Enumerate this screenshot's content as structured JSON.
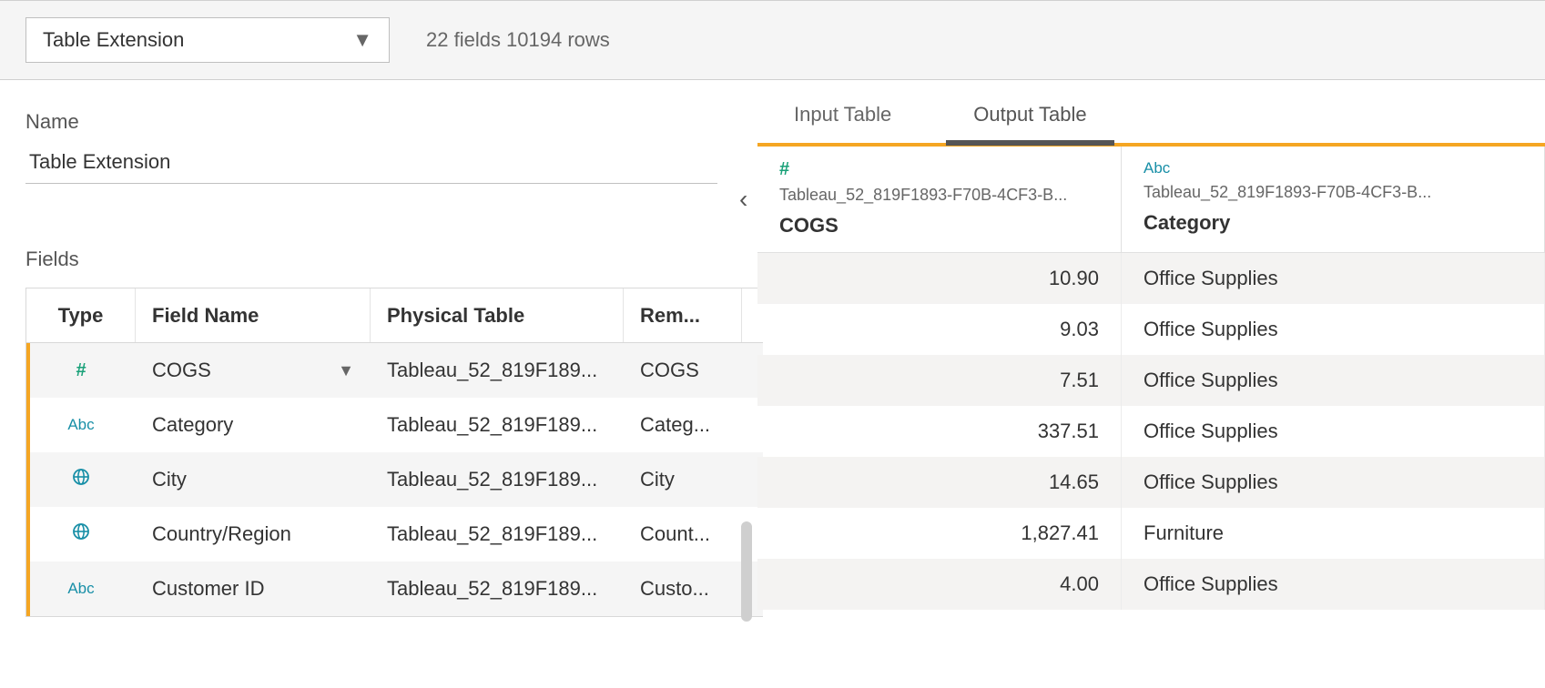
{
  "topbar": {
    "dropdown_value": "Table Extension",
    "summary": "22 fields 10194 rows"
  },
  "left": {
    "name_label": "Name",
    "name_value": "Table Extension",
    "fields_label": "Fields",
    "headers": {
      "type": "Type",
      "field_name": "Field Name",
      "physical": "Physical Table",
      "remote": "Rem..."
    },
    "rows": [
      {
        "type": "num",
        "name": "COGS",
        "phys": "Tableau_52_819F189...",
        "rem": "COGS",
        "sel": true
      },
      {
        "type": "abc",
        "name": "Category",
        "phys": "Tableau_52_819F189...",
        "rem": "Categ...",
        "sel": false
      },
      {
        "type": "geo",
        "name": "City",
        "phys": "Tableau_52_819F189...",
        "rem": "City",
        "sel": false
      },
      {
        "type": "geo",
        "name": "Country/Region",
        "phys": "Tableau_52_819F189...",
        "rem": "Count...",
        "sel": false
      },
      {
        "type": "abc",
        "name": "Customer ID",
        "phys": "Tableau_52_819F189...",
        "rem": "Custo...",
        "sel": false
      }
    ]
  },
  "right": {
    "tabs": {
      "input": "Input Table",
      "output": "Output Table",
      "active": "output"
    },
    "columns": [
      {
        "icon": "num",
        "src": "Tableau_52_819F1893-F70B-4CF3-B...",
        "name": "COGS"
      },
      {
        "icon": "abc",
        "src": "Tableau_52_819F1893-F70B-4CF3-B...",
        "name": "Category"
      }
    ],
    "rows": [
      {
        "cogs": "10.90",
        "cat": "Office Supplies"
      },
      {
        "cogs": "9.03",
        "cat": "Office Supplies"
      },
      {
        "cogs": "7.51",
        "cat": "Office Supplies"
      },
      {
        "cogs": "337.51",
        "cat": "Office Supplies"
      },
      {
        "cogs": "14.65",
        "cat": "Office Supplies"
      },
      {
        "cogs": "1,827.41",
        "cat": "Furniture"
      },
      {
        "cogs": "4.00",
        "cat": "Office Supplies"
      }
    ]
  },
  "icons": {
    "num_glyph": "#",
    "abc_glyph": "Abc",
    "caret_down": "▼",
    "chevron_left": "‹"
  }
}
